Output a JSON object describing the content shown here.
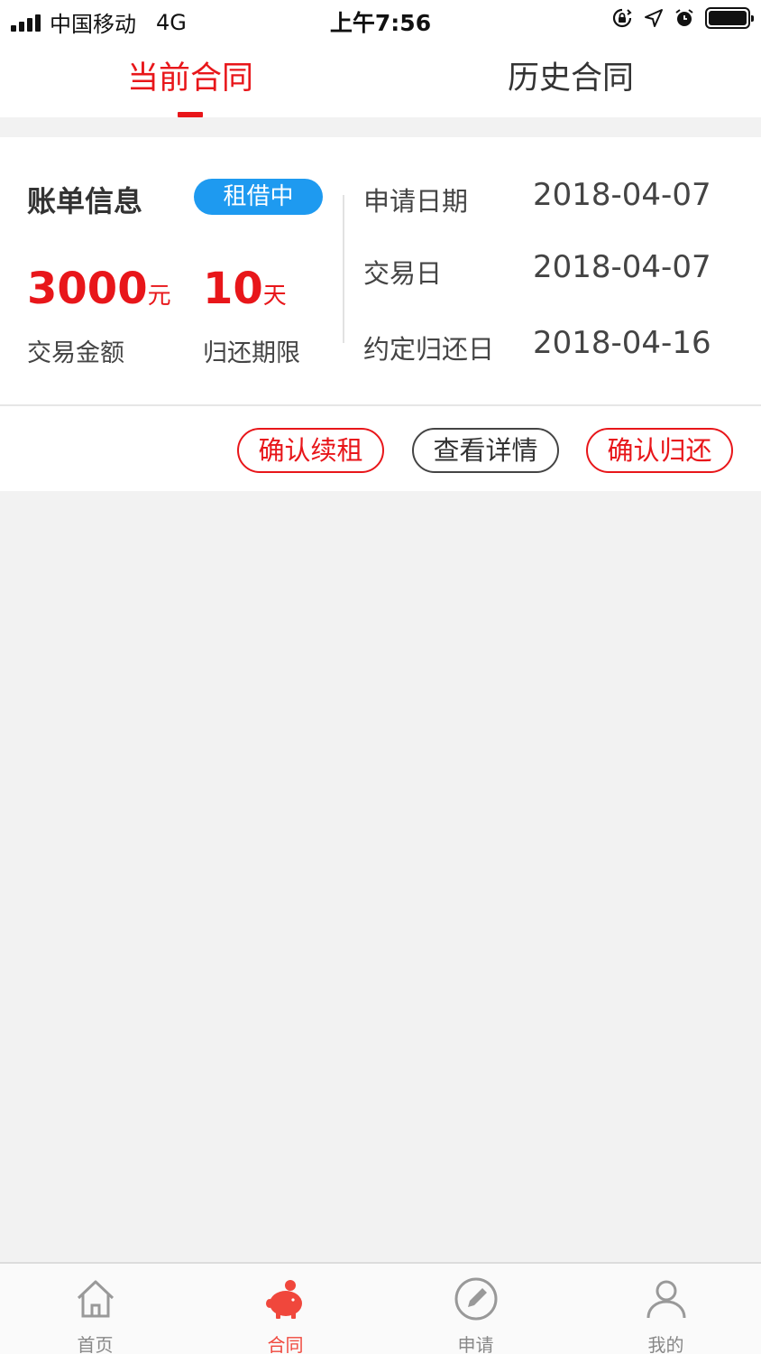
{
  "status_bar": {
    "carrier": "中国移动",
    "network": "4G",
    "time": "上午7:56"
  },
  "tabs": [
    {
      "label": "当前合同",
      "active": true
    },
    {
      "label": "历史合同",
      "active": false
    }
  ],
  "bill": {
    "title": "账单信息",
    "status": "租借中",
    "amount_value": "3000",
    "amount_unit": "元",
    "amount_label": "交易金额",
    "period_value": "10",
    "period_unit": "天",
    "period_label": "归还期限",
    "info": [
      {
        "label": "申请日期",
        "value": "2018-04-07"
      },
      {
        "label": "交易日",
        "value": "2018-04-07"
      },
      {
        "label": "约定归还日",
        "value": "2018-04-16"
      }
    ]
  },
  "actions": {
    "renew": "确认续租",
    "details": "查看详情",
    "return": "确认归还"
  },
  "bottom_nav": [
    {
      "label": "首页",
      "icon": "home-icon",
      "active": false
    },
    {
      "label": "合同",
      "icon": "piggy-bank-icon",
      "active": true
    },
    {
      "label": "申请",
      "icon": "pencil-icon",
      "active": false
    },
    {
      "label": "我的",
      "icon": "user-icon",
      "active": false
    }
  ],
  "colors": {
    "accent": "#e8161a",
    "status_pill": "#1e9af0",
    "nav_active": "#f0473c"
  }
}
